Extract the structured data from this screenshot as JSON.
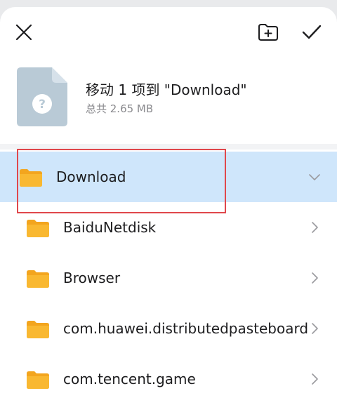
{
  "toolbar": {
    "close_icon": "close-icon",
    "new_folder_icon": "new-folder-icon",
    "confirm_icon": "check-icon"
  },
  "file_info": {
    "title": "移动 1 项到 \"Download\"",
    "size": "总共 2.65 MB",
    "thumb_icon": "unknown-file-icon"
  },
  "colors": {
    "selected_bg": "#cfe6fb",
    "folder": "#f9b831",
    "folder_tab": "#f3a51e",
    "highlight_border": "#e0474c"
  },
  "folders": [
    {
      "name": "Download",
      "selected": true
    },
    {
      "name": "BaiduNetdisk"
    },
    {
      "name": "Browser"
    },
    {
      "name": "com.huawei.distributedpasteboard"
    },
    {
      "name": "com.tencent.game"
    }
  ]
}
